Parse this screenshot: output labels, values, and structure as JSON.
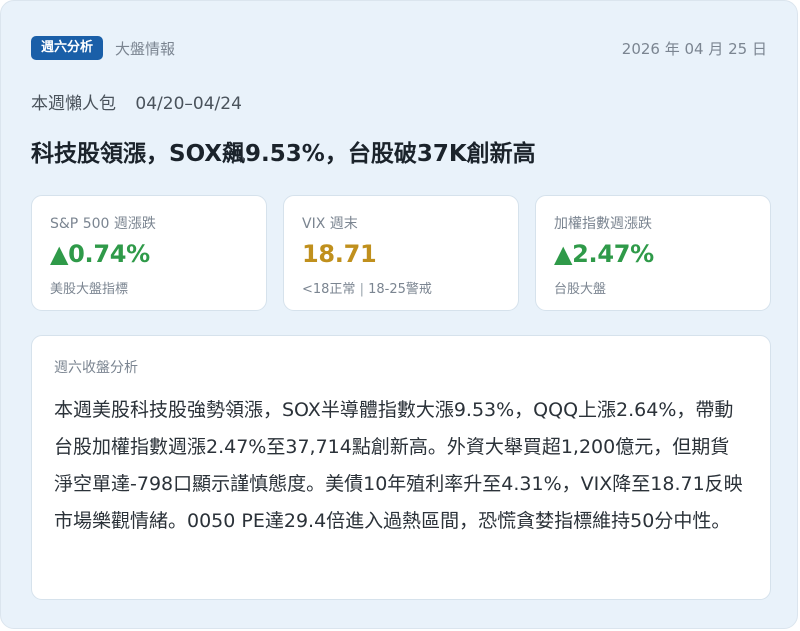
{
  "header": {
    "tag": "週六分析",
    "category": "大盤情報",
    "date": "2026 年 04 月 25 日"
  },
  "summary": {
    "label": "本週懶人包",
    "range": "04/20–04/24",
    "headline": "科技股領漲，SOX飆9.53%，台股破37K創新高"
  },
  "metrics": [
    {
      "label": "S&P 500 週漲跌",
      "value": "▲0.74%",
      "note": "美股大盤指標"
    },
    {
      "label": "VIX 週末",
      "value": "18.71",
      "note_a": "<18正常",
      "note_sep": "|",
      "note_b": "18-25警戒"
    },
    {
      "label": "加權指數週漲跌",
      "value": "▲2.47%",
      "note": "台股大盤"
    }
  ],
  "analysis": {
    "title": "週六收盤分析",
    "body": "本週美股科技股強勢領漲，SOX半導體指數大漲9.53%，QQQ上漲2.64%，帶動台股加權指數週漲2.47%至37,714點創新高。外資大舉買超1,200億元，但期貨淨空單達-798口顯示謹慎態度。美債10年殖利率升至4.31%，VIX降至18.71反映市場樂觀情緒。0050 PE達29.4倍進入過熱區間，恐慌貪婪指標維持50分中性。"
  },
  "colors": {
    "tag_bg": "#1a5fa8",
    "up": "#2f9a49",
    "warn": "#c0901d",
    "panel_bg": "#e9f2fa"
  }
}
